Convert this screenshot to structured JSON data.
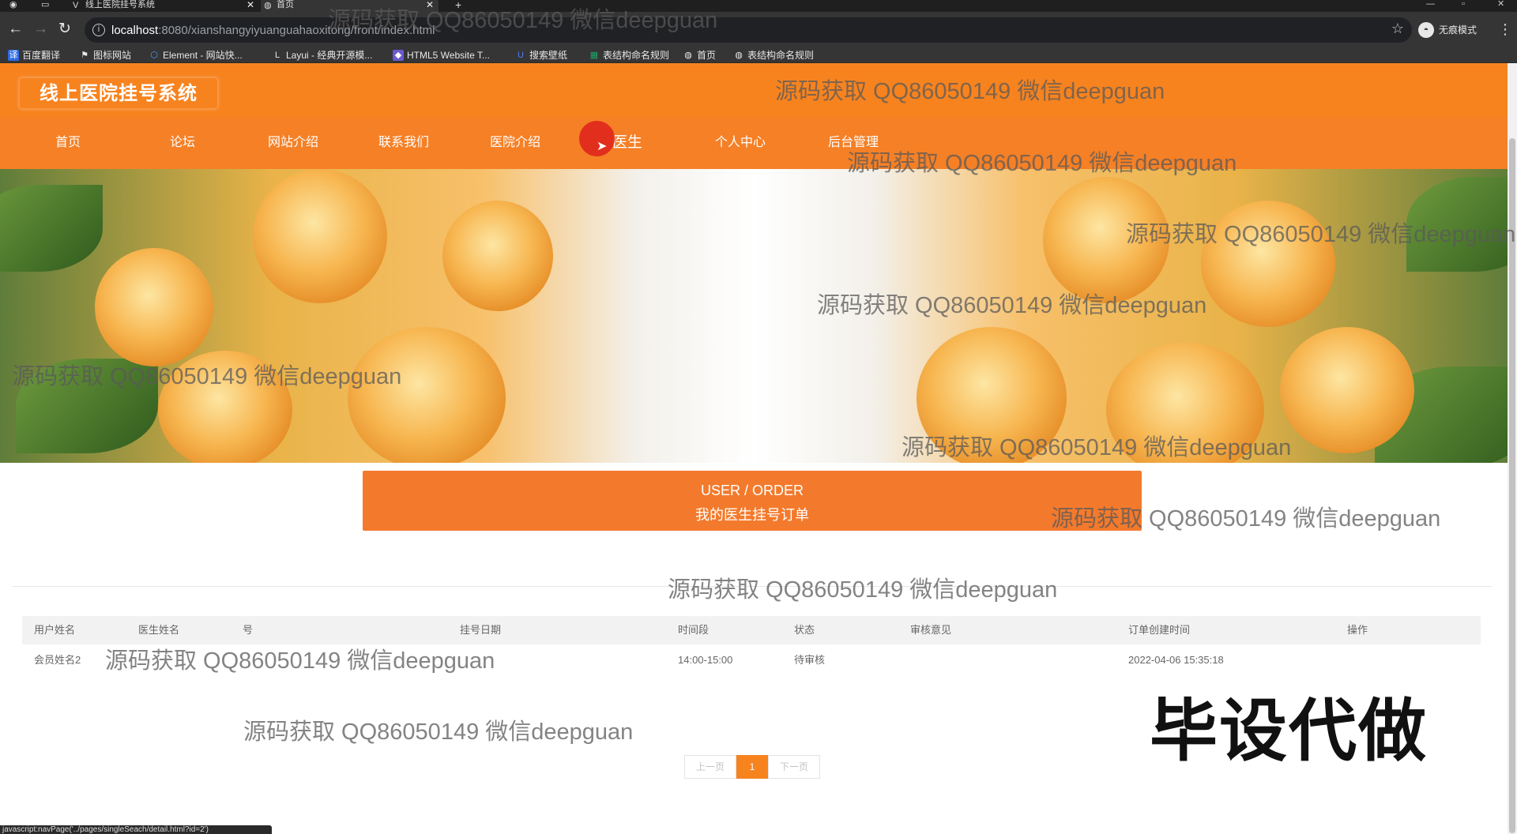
{
  "browser": {
    "tabs": [
      {
        "title": "线上医院挂号系统",
        "active": false
      },
      {
        "title": "首页",
        "active": true
      }
    ],
    "new_tab": "+",
    "url_host": "localhost",
    "url_rest": ":8080/xianshangyiyuanguahaoxitong/front/index.html",
    "profile_label": "无痕模式",
    "bookmarks": [
      "百度翻译",
      "图标网站",
      "Element - 网站快...",
      "Layui - 经典开源模...",
      "HTML5 Website T...",
      "搜索壁纸",
      "表结构命名规则",
      "首页",
      "表结构命名规则"
    ],
    "status_url": "javascript:navPage('../pages/singleSeach/detail.html?id=2')"
  },
  "site": {
    "logo": "线上医院挂号系统",
    "nav": [
      "首页",
      "论坛",
      "网站介绍",
      "联系我们",
      "医院介绍",
      "医生",
      "个人中心",
      "后台管理"
    ]
  },
  "order": {
    "title_en": "USER / ORDER",
    "title_cn": "我的医生挂号订单",
    "columns": [
      "用户姓名",
      "医生姓名",
      "号",
      "挂号日期",
      "时间段",
      "状态",
      "审核意见",
      "订单创建时间",
      "操作"
    ],
    "rows": [
      {
        "user": "会员姓名2",
        "doctor": "",
        "number": "",
        "date": "",
        "time": "14:00-15:00",
        "status": "待审核",
        "review": "",
        "created": "2022-04-06 15:35:18",
        "action": ""
      }
    ],
    "pager": {
      "prev": "上一页",
      "current": "1",
      "next": "下一页"
    }
  },
  "overlay": {
    "watermark": "源码获取 QQ86050149 微信deepguan",
    "stamp": "毕设代做"
  },
  "colors": {
    "primary": "#f7831f",
    "nav": "#f58026",
    "title_bar": "#f37a2c"
  }
}
